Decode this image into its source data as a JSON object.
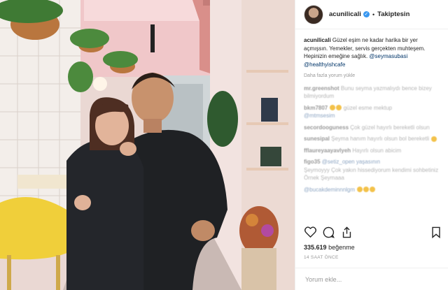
{
  "header": {
    "username": "acunilicali",
    "verified_icon": "verified-badge-icon",
    "separator": "•",
    "follow_label": "Takiptesin"
  },
  "caption": {
    "username": "acunilicali",
    "text": "Güzel eşim ne kadar harika bir yer açmışsın. Yemekler, servis gerçekten muhteşem. Hepinizin emeğine sağlık.",
    "mention1": "@seymasubasi",
    "mention2": "@healthyishcafe",
    "translate": "Daha fazla yorum yükle"
  },
  "comments": [
    {
      "user": "mr.greenshot",
      "text": "Bunu seyma yazmalıydı bence bizey bilmiyordum"
    },
    {
      "user": "bkm7807",
      "text": "güzel esme mektup"
    },
    {
      "user": "",
      "text": "@mtmsesim"
    },
    {
      "user": "secordooguness",
      "text": "Çok güzel hayırlı bereketli olsun"
    },
    {
      "user": "sunesipal",
      "text": "Şeyma hanım hayırlı olsun bol bereketli"
    },
    {
      "user": "fflaureyaayavlyeh",
      "text": "Hayırlı olsun abicim"
    },
    {
      "user": "figo35",
      "text": "@setiz_open yaşasının"
    },
    {
      "user": "",
      "text": "Şeymoyyy Çok yakın hissediyorum kendimi sohbetiniz Örnek Şeymaaa"
    },
    {
      "user": "",
      "text": "@bucakdeminnnlgm"
    }
  ],
  "actions": {
    "like_icon": "heart-icon",
    "comment_icon": "comment-icon",
    "share_icon": "share-icon",
    "save_icon": "bookmark-icon"
  },
  "likes": {
    "count": "335.619",
    "label": "beğenme"
  },
  "time": "14 SAAT ÖNCE",
  "comment_box": {
    "placeholder": "Yorum ekle..."
  }
}
